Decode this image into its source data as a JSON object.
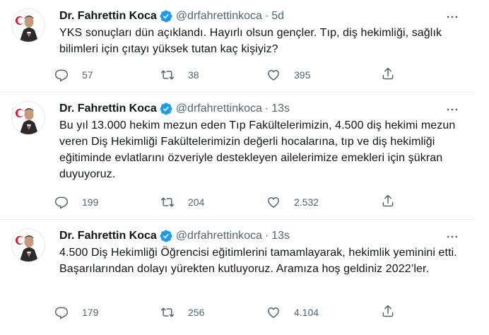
{
  "colors": {
    "verified": "#1d9bf0",
    "muted": "#536471",
    "text": "#0f1419"
  },
  "tweets": [
    {
      "author": "Dr. Fahrettin Koca",
      "handle": "@drfahrettinkoca",
      "separator": "·",
      "time": "5d",
      "text": "YKS sonuçları dün açıklandı. Hayırlı olsun gençler. Tıp, diş hekimliği, sağlık bilimleri için çıtayı yüksek tutan kaç kişiyiz?",
      "replies": "57",
      "retweets": "38",
      "likes": "395"
    },
    {
      "author": "Dr. Fahrettin Koca",
      "handle": "@drfahrettinkoca",
      "separator": "·",
      "time": "13s",
      "text": "Bu yıl 13.000 hekim mezun eden Tıp Fakültelerimizin, 4.500 diş hekimi mezun veren Diş Hekimliği Fakültelerimizin değerli hocalarına, tıp ve diş hekimliği eğitiminde evlatlarını özveriyle destekleyen ailelerimize emekleri için şükran duyuyoruz.",
      "replies": "199",
      "retweets": "204",
      "likes": "2.532"
    },
    {
      "author": "Dr. Fahrettin Koca",
      "handle": "@drfahrettinkoca",
      "separator": "·",
      "time": "13s",
      "text": "4.500 Diş Hekimliği Öğrencisi eğitimlerini tamamlayarak, hekimlik yeminini etti. Başarılarından dolayı yürekten kutluyoruz. Aramıza hoş geldiniz 2022’ler.",
      "replies": "179",
      "retweets": "256",
      "likes": "4.104"
    }
  ]
}
